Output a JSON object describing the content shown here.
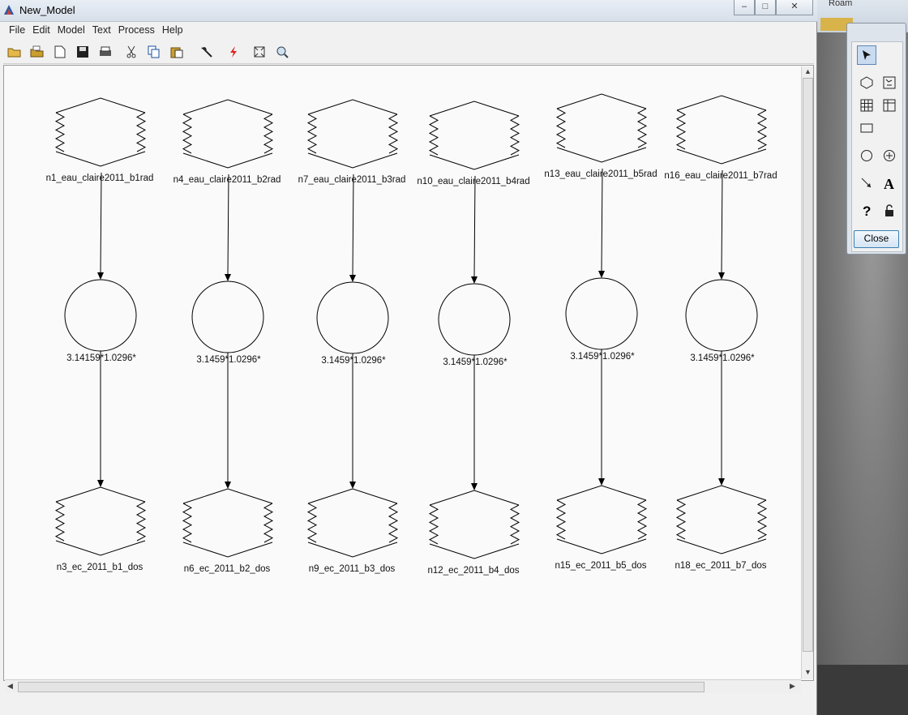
{
  "window": {
    "title": "New_Model",
    "min": "–",
    "max": "□",
    "close": "✕"
  },
  "background": {
    "label": "Roam"
  },
  "menu": [
    "File",
    "Edit",
    "Model",
    "Text",
    "Process",
    "Help"
  ],
  "toolbar_icons": [
    "open-icon",
    "open-folder-icon",
    "new-document-icon",
    "save-icon",
    "print-icon",
    "cut-icon",
    "copy-icon",
    "paste-icon",
    "hammer-icon",
    "run-icon",
    "fit-icon",
    "zoom-icon"
  ],
  "palette": {
    "close_label": "Close",
    "tools": [
      "pointer-icon",
      "raster-icon",
      "vector-icon",
      "matrix-icon",
      "table-icon",
      "rectangle-icon",
      "circle-icon",
      "function-icon",
      "connect-icon",
      "text-icon",
      "help-icon",
      "lock-icon"
    ]
  },
  "model": {
    "columns": [
      {
        "input": "n1_eau_claire2011_b1rad",
        "function": "3.14159*1.0296*",
        "output": "n3_ec_2011_b1_dos"
      },
      {
        "input": "n4_eau_claire2011_b2rad",
        "function": "3.1459*1.0296*",
        "output": "n6_ec_2011_b2_dos"
      },
      {
        "input": "n7_eau_claire2011_b3rad",
        "function": "3.1459*1.0296*",
        "output": "n9_ec_2011_b3_dos"
      },
      {
        "input": "n10_eau_claire2011_b4rad",
        "function": "3.1459*1.0296*",
        "output": "n12_ec_2011_b4_dos"
      },
      {
        "input": "n13_eau_claire2011_b5rad",
        "function": "3.1459*1.0296*",
        "output": "n15_ec_2011_b5_dos"
      },
      {
        "input": "n16_eau_claire2011_b7rad",
        "function": "3.1459*1.0296*",
        "output": "n18_ec_2011_b7_dos"
      }
    ]
  }
}
